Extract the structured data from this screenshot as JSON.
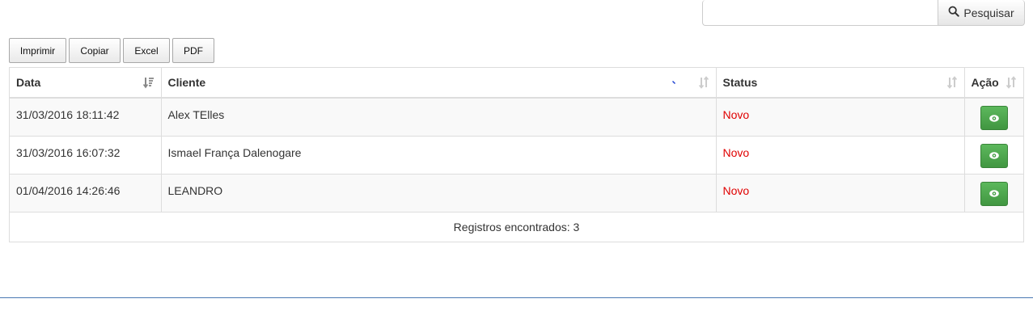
{
  "search": {
    "value": "",
    "button_label": "Pesquisar",
    "icon": "search-icon"
  },
  "export": {
    "buttons": [
      "Imprimir",
      "Copiar",
      "Excel",
      "PDF"
    ]
  },
  "table": {
    "columns": [
      "Data",
      "Cliente",
      "Status",
      "Ação"
    ],
    "rows": [
      {
        "data": "31/03/2016 18:11:42",
        "cliente": "Alex TElles",
        "status": "Novo"
      },
      {
        "data": "31/03/2016 16:07:32",
        "cliente": "Ismael França Dalenogare",
        "status": "Novo"
      },
      {
        "data": "01/04/2016 14:26:46",
        "cliente": "LEANDRO",
        "status": "Novo"
      }
    ],
    "footer": "Registros encontrados: 3",
    "action_icon": "eye-icon"
  },
  "colors": {
    "status_novo": "#e00000",
    "action_button": "#5cb85c",
    "footer_line": "#4a78b3"
  }
}
